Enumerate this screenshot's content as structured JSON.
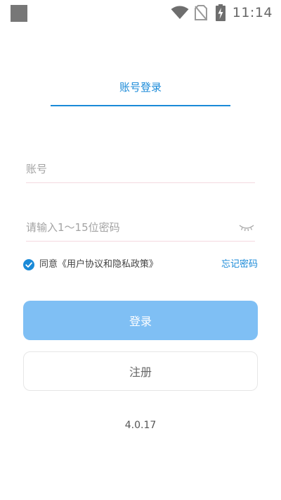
{
  "status_bar": {
    "time": "11:14",
    "icons": [
      "notification-square-icon",
      "wifi-icon",
      "no-sim-icon",
      "battery-charging-icon"
    ]
  },
  "tab": {
    "label": "账号登录"
  },
  "form": {
    "account_placeholder": "账号",
    "account_value": "",
    "password_placeholder": "请输入1～15位密码",
    "password_value": "",
    "password_toggle_icon": "eye-closed-icon"
  },
  "agreement": {
    "checked": true,
    "text": "同意《用户协议和隐私政策》",
    "forgot_label": "忘记密码"
  },
  "buttons": {
    "login_label": "登录",
    "register_label": "注册"
  },
  "version": "4.0.17",
  "colors": {
    "accent": "#1a8ad8",
    "login_button": "#7fbff4",
    "input_underline": "#f4d9e0"
  }
}
